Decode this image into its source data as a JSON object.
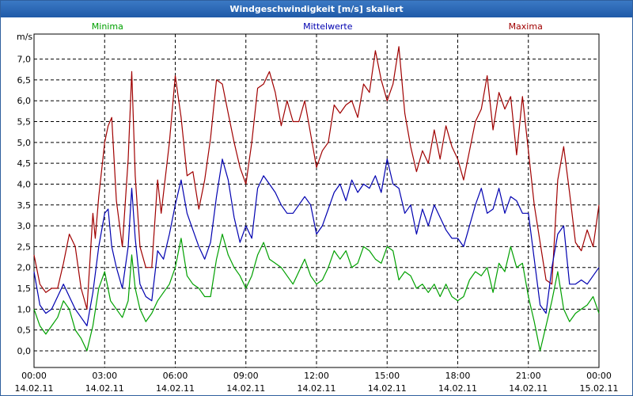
{
  "window": {
    "title": "Windgeschwindigkeit [m/s] skaliert"
  },
  "colors": {
    "minima": "#00a000",
    "mittelwerte": "#0000b0",
    "maxima": "#a00000",
    "grid": "#000000"
  },
  "chart_data": {
    "type": "line",
    "title": "Windgeschwindigkeit [m/s] skaliert",
    "ylabel": "m/s",
    "ylim": [
      -0.4,
      7.6
    ],
    "yticks": [
      "0,0",
      "0,5",
      "1,0",
      "1,5",
      "2,0",
      "2,5",
      "3,0",
      "3,5",
      "4,0",
      "4,5",
      "5,0",
      "5,5",
      "6,0",
      "6,5",
      "7,0"
    ],
    "xlim": [
      0,
      24
    ],
    "xticks": [
      {
        "time": "00:00",
        "date": "14.02.11"
      },
      {
        "time": "03:00",
        "date": "14.02.11"
      },
      {
        "time": "06:00",
        "date": "14.02.11"
      },
      {
        "time": "09:00",
        "date": "14.02.11"
      },
      {
        "time": "12:00",
        "date": "14.02.11"
      },
      {
        "time": "15:00",
        "date": "14.02.11"
      },
      {
        "time": "18:00",
        "date": "14.02.11"
      },
      {
        "time": "21:00",
        "date": "14.02.11"
      },
      {
        "time": "00:00",
        "date": "15.02.11"
      }
    ],
    "grid": true,
    "legend_position": "top",
    "series": [
      {
        "name": "Maxima",
        "color": "#a00000",
        "points": [
          [
            0.0,
            2.3
          ],
          [
            0.25,
            1.6
          ],
          [
            0.5,
            1.4
          ],
          [
            0.75,
            1.5
          ],
          [
            1.0,
            1.5
          ],
          [
            1.25,
            2.1
          ],
          [
            1.5,
            2.8
          ],
          [
            1.75,
            2.5
          ],
          [
            2.0,
            1.5
          ],
          [
            2.25,
            1.0
          ],
          [
            2.5,
            3.3
          ],
          [
            2.6,
            2.7
          ],
          [
            2.75,
            3.7
          ],
          [
            3.0,
            5.0
          ],
          [
            3.15,
            5.4
          ],
          [
            3.3,
            5.6
          ],
          [
            3.5,
            3.6
          ],
          [
            3.75,
            2.5
          ],
          [
            4.0,
            4.6
          ],
          [
            4.15,
            6.7
          ],
          [
            4.3,
            4.2
          ],
          [
            4.5,
            2.5
          ],
          [
            4.75,
            2.0
          ],
          [
            5.0,
            2.0
          ],
          [
            5.25,
            4.1
          ],
          [
            5.4,
            3.3
          ],
          [
            5.75,
            5.0
          ],
          [
            6.0,
            6.6
          ],
          [
            6.25,
            5.6
          ],
          [
            6.5,
            4.2
          ],
          [
            6.75,
            4.3
          ],
          [
            7.0,
            3.4
          ],
          [
            7.25,
            4.1
          ],
          [
            7.5,
            5.1
          ],
          [
            7.75,
            6.5
          ],
          [
            8.0,
            6.4
          ],
          [
            8.25,
            5.7
          ],
          [
            8.5,
            5.0
          ],
          [
            8.75,
            4.4
          ],
          [
            9.0,
            4.0
          ],
          [
            9.25,
            5.0
          ],
          [
            9.5,
            6.3
          ],
          [
            9.75,
            6.4
          ],
          [
            10.0,
            6.7
          ],
          [
            10.25,
            6.2
          ],
          [
            10.5,
            5.4
          ],
          [
            10.75,
            6.0
          ],
          [
            11.0,
            5.5
          ],
          [
            11.25,
            5.5
          ],
          [
            11.5,
            6.0
          ],
          [
            11.75,
            5.2
          ],
          [
            12.0,
            4.4
          ],
          [
            12.25,
            4.8
          ],
          [
            12.5,
            5.0
          ],
          [
            12.75,
            5.9
          ],
          [
            13.0,
            5.7
          ],
          [
            13.25,
            5.9
          ],
          [
            13.5,
            6.0
          ],
          [
            13.75,
            5.6
          ],
          [
            14.0,
            6.4
          ],
          [
            14.25,
            6.2
          ],
          [
            14.5,
            7.2
          ],
          [
            14.75,
            6.5
          ],
          [
            15.0,
            6.0
          ],
          [
            15.25,
            6.4
          ],
          [
            15.5,
            7.3
          ],
          [
            15.75,
            5.7
          ],
          [
            16.0,
            4.9
          ],
          [
            16.25,
            4.3
          ],
          [
            16.5,
            4.8
          ],
          [
            16.75,
            4.5
          ],
          [
            17.0,
            5.3
          ],
          [
            17.25,
            4.6
          ],
          [
            17.5,
            5.4
          ],
          [
            17.75,
            4.9
          ],
          [
            18.0,
            4.6
          ],
          [
            18.25,
            4.1
          ],
          [
            18.5,
            4.8
          ],
          [
            18.75,
            5.5
          ],
          [
            19.0,
            5.8
          ],
          [
            19.25,
            6.6
          ],
          [
            19.5,
            5.3
          ],
          [
            19.75,
            6.2
          ],
          [
            20.0,
            5.8
          ],
          [
            20.25,
            6.1
          ],
          [
            20.5,
            4.7
          ],
          [
            20.75,
            6.1
          ],
          [
            21.0,
            4.8
          ],
          [
            21.25,
            3.5
          ],
          [
            21.5,
            2.6
          ],
          [
            21.75,
            1.7
          ],
          [
            22.0,
            1.6
          ],
          [
            22.25,
            4.1
          ],
          [
            22.5,
            4.9
          ],
          [
            22.75,
            3.8
          ],
          [
            23.0,
            2.6
          ],
          [
            23.25,
            2.4
          ],
          [
            23.5,
            2.9
          ],
          [
            23.75,
            2.5
          ],
          [
            24.0,
            3.5
          ]
        ]
      },
      {
        "name": "Mittelwerte",
        "color": "#0000b0",
        "points": [
          [
            0.0,
            1.9
          ],
          [
            0.25,
            1.1
          ],
          [
            0.5,
            0.9
          ],
          [
            0.75,
            1.0
          ],
          [
            1.0,
            1.3
          ],
          [
            1.25,
            1.6
          ],
          [
            1.5,
            1.3
          ],
          [
            1.75,
            1.0
          ],
          [
            2.0,
            0.8
          ],
          [
            2.25,
            0.6
          ],
          [
            2.5,
            1.4
          ],
          [
            2.75,
            2.5
          ],
          [
            3.0,
            3.3
          ],
          [
            3.15,
            3.4
          ],
          [
            3.3,
            2.5
          ],
          [
            3.5,
            2.0
          ],
          [
            3.75,
            1.5
          ],
          [
            4.0,
            2.5
          ],
          [
            4.15,
            3.9
          ],
          [
            4.3,
            2.7
          ],
          [
            4.5,
            1.6
          ],
          [
            4.75,
            1.3
          ],
          [
            5.0,
            1.2
          ],
          [
            5.25,
            2.4
          ],
          [
            5.5,
            2.2
          ],
          [
            5.75,
            2.8
          ],
          [
            6.0,
            3.5
          ],
          [
            6.25,
            4.1
          ],
          [
            6.5,
            3.3
          ],
          [
            6.75,
            2.9
          ],
          [
            7.0,
            2.5
          ],
          [
            7.25,
            2.2
          ],
          [
            7.5,
            2.6
          ],
          [
            7.75,
            3.7
          ],
          [
            8.0,
            4.6
          ],
          [
            8.25,
            4.1
          ],
          [
            8.5,
            3.2
          ],
          [
            8.75,
            2.6
          ],
          [
            9.0,
            3.0
          ],
          [
            9.25,
            2.7
          ],
          [
            9.5,
            3.9
          ],
          [
            9.75,
            4.2
          ],
          [
            10.0,
            4.0
          ],
          [
            10.25,
            3.8
          ],
          [
            10.5,
            3.5
          ],
          [
            10.75,
            3.3
          ],
          [
            11.0,
            3.3
          ],
          [
            11.25,
            3.5
          ],
          [
            11.5,
            3.7
          ],
          [
            11.75,
            3.5
          ],
          [
            12.0,
            2.8
          ],
          [
            12.25,
            3.0
          ],
          [
            12.5,
            3.4
          ],
          [
            12.75,
            3.8
          ],
          [
            13.0,
            4.0
          ],
          [
            13.25,
            3.6
          ],
          [
            13.5,
            4.1
          ],
          [
            13.75,
            3.8
          ],
          [
            14.0,
            4.0
          ],
          [
            14.25,
            3.9
          ],
          [
            14.5,
            4.2
          ],
          [
            14.75,
            3.8
          ],
          [
            15.0,
            4.6
          ],
          [
            15.25,
            4.0
          ],
          [
            15.5,
            3.9
          ],
          [
            15.75,
            3.3
          ],
          [
            16.0,
            3.5
          ],
          [
            16.25,
            2.8
          ],
          [
            16.5,
            3.4
          ],
          [
            16.75,
            3.0
          ],
          [
            17.0,
            3.5
          ],
          [
            17.25,
            3.2
          ],
          [
            17.5,
            2.9
          ],
          [
            17.75,
            2.7
          ],
          [
            18.0,
            2.7
          ],
          [
            18.25,
            2.5
          ],
          [
            18.5,
            3.0
          ],
          [
            18.75,
            3.5
          ],
          [
            19.0,
            3.9
          ],
          [
            19.25,
            3.3
          ],
          [
            19.5,
            3.4
          ],
          [
            19.75,
            3.9
          ],
          [
            20.0,
            3.3
          ],
          [
            20.25,
            3.7
          ],
          [
            20.5,
            3.6
          ],
          [
            20.75,
            3.3
          ],
          [
            21.0,
            3.3
          ],
          [
            21.25,
            2.2
          ],
          [
            21.5,
            1.1
          ],
          [
            21.75,
            0.9
          ],
          [
            22.0,
            2.0
          ],
          [
            22.25,
            2.8
          ],
          [
            22.5,
            3.0
          ],
          [
            22.75,
            1.6
          ],
          [
            23.0,
            1.6
          ],
          [
            23.25,
            1.7
          ],
          [
            23.5,
            1.6
          ],
          [
            23.75,
            1.8
          ],
          [
            24.0,
            2.0
          ]
        ]
      },
      {
        "name": "Minima",
        "color": "#00a000",
        "points": [
          [
            0.0,
            1.0
          ],
          [
            0.25,
            0.6
          ],
          [
            0.5,
            0.4
          ],
          [
            0.75,
            0.6
          ],
          [
            1.0,
            0.8
          ],
          [
            1.25,
            1.2
          ],
          [
            1.5,
            1.0
          ],
          [
            1.75,
            0.5
          ],
          [
            2.0,
            0.3
          ],
          [
            2.25,
            0.0
          ],
          [
            2.5,
            0.6
          ],
          [
            2.75,
            1.5
          ],
          [
            3.0,
            1.9
          ],
          [
            3.25,
            1.2
          ],
          [
            3.5,
            1.0
          ],
          [
            3.75,
            0.8
          ],
          [
            4.0,
            1.2
          ],
          [
            4.15,
            2.3
          ],
          [
            4.3,
            1.5
          ],
          [
            4.5,
            1.0
          ],
          [
            4.75,
            0.7
          ],
          [
            5.0,
            0.9
          ],
          [
            5.25,
            1.2
          ],
          [
            5.5,
            1.4
          ],
          [
            5.75,
            1.6
          ],
          [
            6.0,
            2.0
          ],
          [
            6.25,
            2.7
          ],
          [
            6.5,
            1.8
          ],
          [
            6.75,
            1.6
          ],
          [
            7.0,
            1.5
          ],
          [
            7.25,
            1.3
          ],
          [
            7.5,
            1.3
          ],
          [
            7.75,
            2.2
          ],
          [
            8.0,
            2.8
          ],
          [
            8.25,
            2.3
          ],
          [
            8.5,
            2.0
          ],
          [
            8.75,
            1.8
          ],
          [
            9.0,
            1.5
          ],
          [
            9.25,
            1.8
          ],
          [
            9.5,
            2.3
          ],
          [
            9.75,
            2.6
          ],
          [
            10.0,
            2.2
          ],
          [
            10.25,
            2.1
          ],
          [
            10.5,
            2.0
          ],
          [
            10.75,
            1.8
          ],
          [
            11.0,
            1.6
          ],
          [
            11.25,
            1.9
          ],
          [
            11.5,
            2.2
          ],
          [
            11.75,
            1.8
          ],
          [
            12.0,
            1.6
          ],
          [
            12.25,
            1.7
          ],
          [
            12.5,
            2.0
          ],
          [
            12.75,
            2.4
          ],
          [
            13.0,
            2.2
          ],
          [
            13.25,
            2.4
          ],
          [
            13.5,
            2.0
          ],
          [
            13.75,
            2.1
          ],
          [
            14.0,
            2.5
          ],
          [
            14.25,
            2.4
          ],
          [
            14.5,
            2.2
          ],
          [
            14.75,
            2.1
          ],
          [
            15.0,
            2.5
          ],
          [
            15.25,
            2.4
          ],
          [
            15.5,
            1.7
          ],
          [
            15.75,
            1.9
          ],
          [
            16.0,
            1.8
          ],
          [
            16.25,
            1.5
          ],
          [
            16.5,
            1.6
          ],
          [
            16.75,
            1.4
          ],
          [
            17.0,
            1.6
          ],
          [
            17.25,
            1.3
          ],
          [
            17.5,
            1.6
          ],
          [
            17.75,
            1.3
          ],
          [
            18.0,
            1.2
          ],
          [
            18.25,
            1.3
          ],
          [
            18.5,
            1.7
          ],
          [
            18.75,
            1.9
          ],
          [
            19.0,
            1.8
          ],
          [
            19.25,
            2.0
          ],
          [
            19.5,
            1.4
          ],
          [
            19.75,
            2.1
          ],
          [
            20.0,
            1.9
          ],
          [
            20.25,
            2.5
          ],
          [
            20.5,
            2.0
          ],
          [
            20.75,
            2.1
          ],
          [
            21.0,
            1.3
          ],
          [
            21.25,
            0.7
          ],
          [
            21.5,
            0.0
          ],
          [
            21.75,
            0.6
          ],
          [
            22.0,
            1.2
          ],
          [
            22.25,
            1.9
          ],
          [
            22.5,
            1.0
          ],
          [
            22.75,
            0.7
          ],
          [
            23.0,
            0.9
          ],
          [
            23.25,
            1.0
          ],
          [
            23.5,
            1.1
          ],
          [
            23.75,
            1.3
          ],
          [
            24.0,
            0.9
          ]
        ]
      }
    ]
  }
}
